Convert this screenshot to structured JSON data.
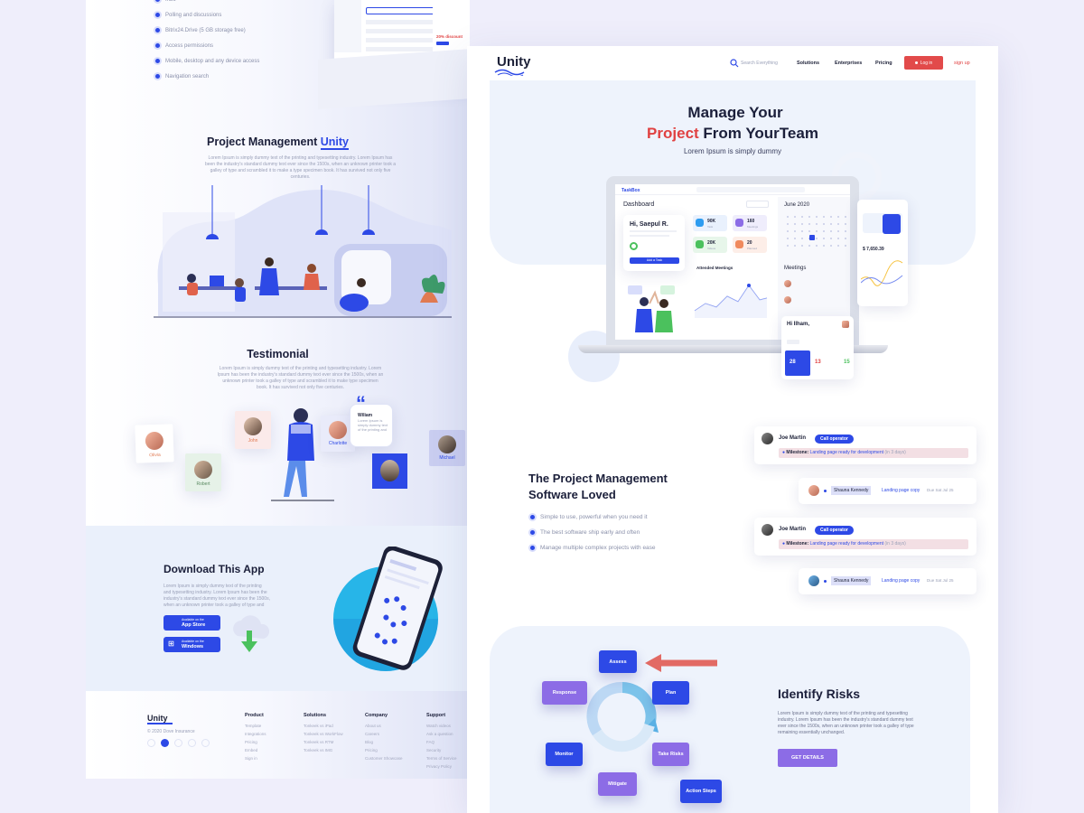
{
  "left": {
    "features": [
      "Polling and discussions",
      "Bitrix24.Drive (5 GB storage free)",
      "Access permissions",
      "Mobile, desktop and any device access",
      "Navigation search"
    ],
    "discount": "20% discount",
    "pm_title_a": "Project Management",
    "pm_title_b": "Unity",
    "pm_text": "Lorem Ipsum is simply dummy text of the printing and typesetting industry. Lorem Ipsum has been the industry's standard dummy text ever since the 1500s, when an unknown printer took a galley of type and scrambled it to make a type specimen book. It has survived not only five centuries.",
    "testimonial_title": "Testimonial",
    "testimonial_text": "Lorem Ipsum is simply dummy text of the printing and typesetting industry. Lorem Ipsum has been the industry's standard dummy text ever since the 1500s, when an unknown printer took a galley of type and scrambled it to make type specimen book. It has survived not only five centuries.",
    "people": [
      "Olivia",
      "John",
      "Robert",
      "Charlotte",
      "Michael"
    ],
    "quote_name": "Wiliam",
    "quote_text": "Lorem Ipsum is simply dummy text of the printing and",
    "download_title": "Download This App",
    "download_text": "Lorem Ipsum is simply dummy text of the printing and typesetting industry. Lorem Ipsum has been the industry's standard dummy text ever since the 1500s, when an unknown printer took a galley of type and",
    "store_small": "Available on the",
    "store_app": "App Store",
    "store_win": "Windows",
    "footer": {
      "brand": "Unity",
      "copyright": "© 2020 Dove Insurance",
      "cols": [
        {
          "title": "Product",
          "links": [
            "Template",
            "Integrations",
            "Pricing",
            "Embed",
            "Sign in"
          ]
        },
        {
          "title": "Solutions",
          "links": [
            "Tonkeek vs iPad",
            "Tonkeek vs WorkFlow",
            "Tonkeek vs RTM",
            "Tonkeek vs IMG"
          ]
        },
        {
          "title": "Company",
          "links": [
            "About us",
            "Careers",
            "Blog",
            "Pricing",
            "Customer Showcase"
          ]
        },
        {
          "title": "Support",
          "links": [
            "Watch videos",
            "Ask a question",
            "FAQ",
            "Security",
            "Terms of Service",
            "Privacy Policy"
          ]
        }
      ]
    }
  },
  "nav": {
    "brand": "Unity",
    "search": "Search Everything",
    "items": [
      "Solutions",
      "Enterprises",
      "Pricing"
    ],
    "login": "Log in",
    "signup": "sign up"
  },
  "hero": {
    "line1": "Manage Your",
    "line2_accent": "Project",
    "line2_rest": "From YourTeam",
    "sub": "Lorem Ipsum is simply dummy"
  },
  "dashboard": {
    "logo": "TaskBox",
    "title": "Dashboard",
    "greeting": "Hi, Saepul R.",
    "stats": [
      {
        "v": "90K",
        "l": "Task"
      },
      {
        "v": "160",
        "l": "Meetings"
      },
      {
        "v": "20K",
        "l": "Videos"
      },
      {
        "v": "20",
        "l": "Planned"
      }
    ],
    "btn": "Add a Task",
    "attended": "Attended Meetings",
    "month": "June 2020",
    "meetings": "Meetings",
    "money": "$ 7,650.39",
    "mobile_greet": "Hi Ilham,",
    "mobile_nums": [
      "28",
      "13",
      "15"
    ]
  },
  "loved": {
    "title_1": "The Project Management",
    "title_2": "Software Loved",
    "points": [
      "Simple to use, powerful when you need it",
      "The best software ship early and often",
      "Manage multiple complex projects with ease"
    ]
  },
  "cards": [
    {
      "name": "Joe Martin",
      "role": "Call operator",
      "milestone": "Milestone:",
      "task": "Landing page ready for development",
      "due": "(in 3 days)"
    },
    {
      "name": "Shauna Kennedy",
      "task": "Landing page copy",
      "due": "Due Sat Jul 25"
    },
    {
      "name": "Joe Martin",
      "role": "Call operator",
      "milestone": "Milestone:",
      "task": "Landing page ready for development",
      "due": "(in 3 days)"
    },
    {
      "name": "Shauna Kennedy",
      "task": "Landing page copy",
      "due": "Due Sat Jul 25"
    }
  ],
  "risks": {
    "nodes": [
      "Assess",
      "Response",
      "Plan",
      "Monitor",
      "Take Risks",
      "Mitigate",
      "Action Steps"
    ],
    "title": "Identify Risks",
    "text": "Lorem Ipsum is simply dummy text of the printing and typesetting industry. Lorem Ipsum has been the industry's standard dummy text ever since the 1500s, when an unknown printer took a galley of type remaining essentially unchanged.",
    "cta": "GET DETAILS"
  },
  "colors": {
    "primary": "#2d49e6",
    "accent": "#e04141",
    "purple": "#8c6ce6"
  }
}
